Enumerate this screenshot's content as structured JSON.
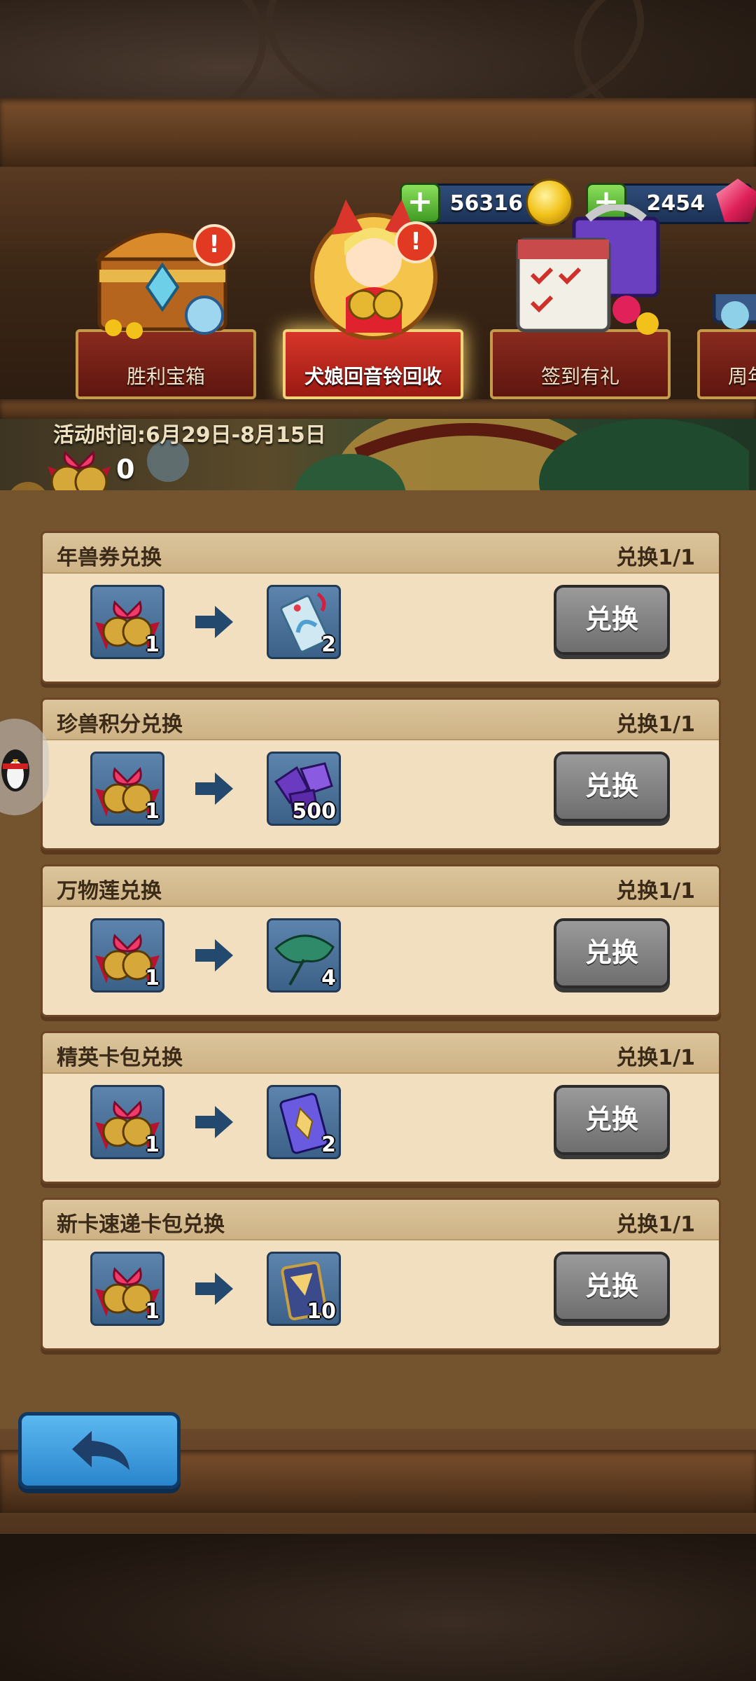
{
  "currencies": [
    {
      "value": "56316",
      "icon": "gold-coin-icon"
    },
    {
      "value": "2454",
      "icon": "red-gem-icon"
    }
  ],
  "tabs": [
    {
      "label": "胜利宝箱",
      "badge": "!"
    },
    {
      "label": "犬娘回音铃回收",
      "badge": "!"
    },
    {
      "label": "签到有礼"
    },
    {
      "label": "周年"
    }
  ],
  "banner": {
    "time": "活动时间:6月29日-8月15日",
    "bell_count": "0"
  },
  "exchanges": [
    {
      "title": "年兽券兑换",
      "limit": "兑换1/1",
      "cost_qty": "1",
      "reward_qty": "2",
      "reward_icon": "ticket-icon",
      "button": "兑换"
    },
    {
      "title": "珍兽积分兑换",
      "limit": "兑换1/1",
      "cost_qty": "1",
      "reward_qty": "500",
      "reward_icon": "purple-crystal-icon",
      "button": "兑换"
    },
    {
      "title": "万物莲兑换",
      "limit": "兑换1/1",
      "cost_qty": "1",
      "reward_qty": "4",
      "reward_icon": "lotus-leaf-icon",
      "button": "兑换"
    },
    {
      "title": "精英卡包兑换",
      "limit": "兑换1/1",
      "cost_qty": "1",
      "reward_qty": "2",
      "reward_icon": "elite-card-pack-icon",
      "button": "兑换"
    },
    {
      "title": "新卡速递卡包兑换",
      "limit": "兑换1/1",
      "cost_qty": "1",
      "reward_qty": "10",
      "reward_icon": "express-card-pack-icon",
      "button": "兑换"
    }
  ],
  "back_icon": "back-arrow-icon"
}
